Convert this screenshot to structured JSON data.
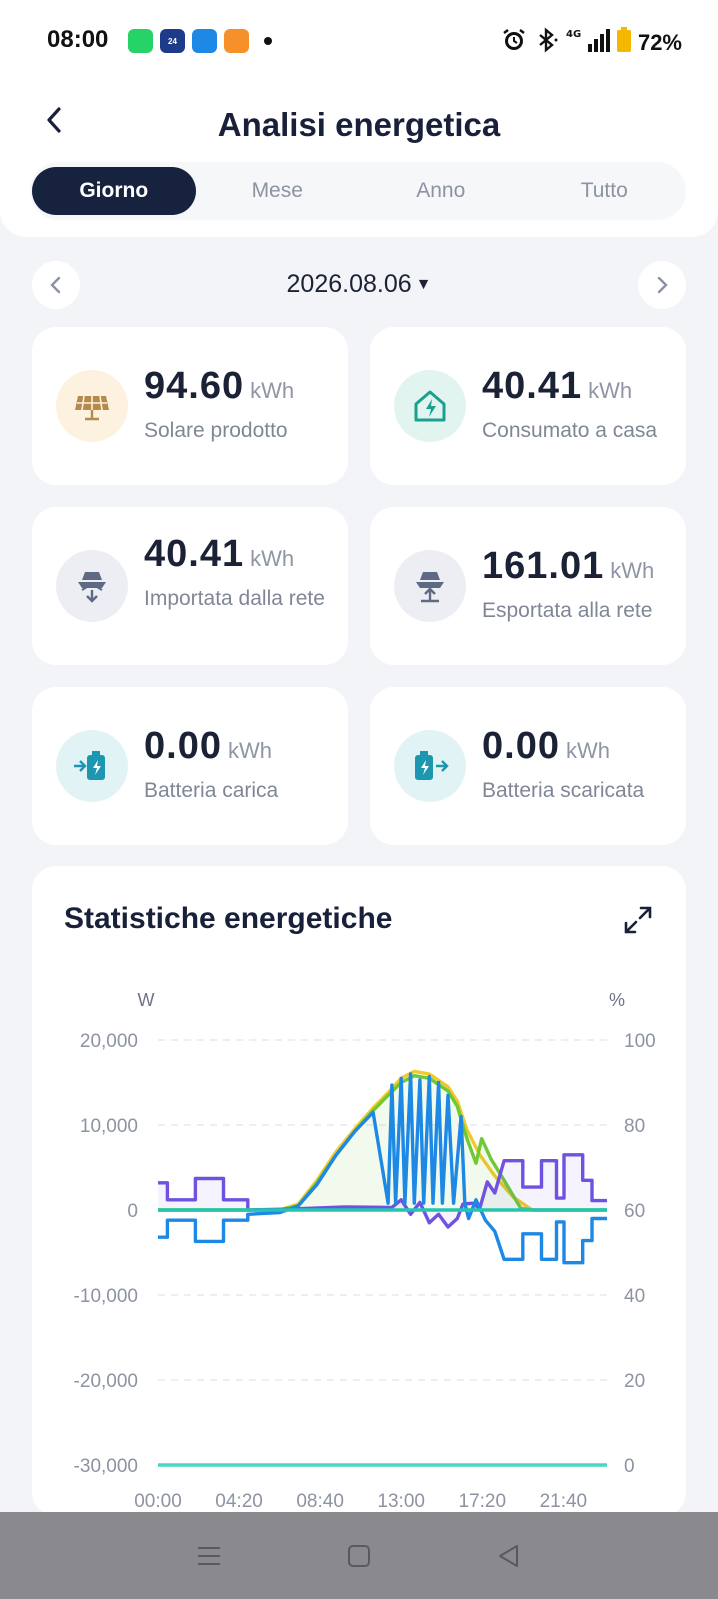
{
  "status": {
    "time": "08:00",
    "battery": "72%",
    "network": "4G",
    "apps": [
      {
        "name": "whatsapp-icon",
        "color": "#25d366",
        "text": ""
      },
      {
        "name": "tgcom24-icon",
        "color": "#1e3a8a",
        "text": "24"
      },
      {
        "name": "news-app-icon",
        "color": "#1e88e5",
        "text": ""
      },
      {
        "name": "orange-app-icon",
        "color": "#f5902a",
        "text": ""
      }
    ]
  },
  "header": {
    "title": "Analisi energetica",
    "tabs": [
      {
        "label": "Giorno",
        "active": true
      },
      {
        "label": "Mese",
        "active": false
      },
      {
        "label": "Anno",
        "active": false
      },
      {
        "label": "Tutto",
        "active": false
      }
    ]
  },
  "date": {
    "label": "2026.08.06"
  },
  "stats": [
    {
      "value": "94.60",
      "unit": "kWh",
      "label": "Solare prodotto",
      "icon": "solar-panel-icon",
      "bg": "#fdf1e0",
      "fg": "#b58a4a"
    },
    {
      "value": "40.41",
      "unit": "kWh",
      "label": "Consumato a casa",
      "icon": "home-energy-icon",
      "bg": "#e2f4f0",
      "fg": "#18a28e"
    },
    {
      "value": "40.41",
      "unit": "kWh",
      "label": "Importata dalla rete",
      "icon": "grid-import-icon",
      "bg": "#eceef3",
      "fg": "#5e6a83"
    },
    {
      "value": "161.01",
      "unit": "kWh",
      "label": "Esportata alla rete",
      "icon": "grid-export-icon",
      "bg": "#eceef3",
      "fg": "#5e6a83"
    },
    {
      "value": "0.00",
      "unit": "kWh",
      "label": "Batteria carica",
      "icon": "battery-charge-icon",
      "bg": "#e2f3f6",
      "fg": "#1d96b0"
    },
    {
      "value": "0.00",
      "unit": "kWh",
      "label": "Batteria scaricata",
      "icon": "battery-discharge-icon",
      "bg": "#e2f3f6",
      "fg": "#1d96b0"
    }
  ],
  "chart_section": {
    "title": "Statistiche energetiche"
  },
  "chart_data": {
    "type": "line",
    "title": "Statistiche energetiche",
    "y_left_unit": "W",
    "y_right_unit": "%",
    "y_left_ticks": [
      "20,000",
      "10,000",
      "0",
      "-10,000",
      "-20,000",
      "-30,000"
    ],
    "y_left_values": [
      20000,
      10000,
      0,
      -10000,
      -20000,
      -30000
    ],
    "y_right_ticks": [
      "100",
      "80",
      "60",
      "40",
      "20",
      "0"
    ],
    "x_ticks": [
      "00:00",
      "04:20",
      "08:40",
      "13:00",
      "17:20",
      "21:40"
    ],
    "ylim": [
      -30000,
      20000
    ],
    "xlim_hours": [
      0,
      24
    ],
    "grid": true,
    "series": [
      {
        "color": "#f0c92c",
        "axis": "left",
        "points": [
          [
            0,
            0
          ],
          [
            5,
            0
          ],
          [
            6.5,
            0
          ],
          [
            7.5,
            700
          ],
          [
            8.5,
            3500
          ],
          [
            9.5,
            6800
          ],
          [
            10.5,
            9500
          ],
          [
            11.5,
            12000
          ],
          [
            12.3,
            13800
          ],
          [
            13,
            15500
          ],
          [
            13.7,
            16300
          ],
          [
            14.5,
            16000
          ],
          [
            15.5,
            14500
          ],
          [
            16,
            12800
          ],
          [
            16.5,
            9500
          ],
          [
            17.2,
            6500
          ],
          [
            18,
            4000
          ],
          [
            19,
            1500
          ],
          [
            20,
            0
          ],
          [
            24,
            0
          ]
        ]
      },
      {
        "color": "#6fc935",
        "axis": "left",
        "points": [
          [
            0,
            0
          ],
          [
            5,
            0
          ],
          [
            6.5,
            0
          ],
          [
            7.5,
            500
          ],
          [
            8.5,
            3200
          ],
          [
            9.5,
            6400
          ],
          [
            10.5,
            9200
          ],
          [
            11.5,
            11700
          ],
          [
            12.3,
            13500
          ],
          [
            13,
            15000
          ],
          [
            13.7,
            15800
          ],
          [
            14.5,
            15500
          ],
          [
            15.5,
            14000
          ],
          [
            16,
            12200
          ],
          [
            16.5,
            8500
          ],
          [
            17,
            5500
          ],
          [
            17.3,
            8400
          ],
          [
            17.8,
            6000
          ],
          [
            18.5,
            3500
          ],
          [
            19.2,
            900
          ],
          [
            19.4,
            200
          ],
          [
            20,
            0
          ],
          [
            24,
            0
          ]
        ]
      },
      {
        "color": "#7052e0",
        "axis": "left",
        "points": [
          [
            0,
            3200
          ],
          [
            0.5,
            3200
          ],
          [
            0.5,
            1200
          ],
          [
            2,
            1200
          ],
          [
            2,
            3700
          ],
          [
            3.5,
            3700
          ],
          [
            3.5,
            1200
          ],
          [
            4.8,
            1200
          ],
          [
            4.8,
            0
          ],
          [
            7,
            100
          ],
          [
            10,
            350
          ],
          [
            12.5,
            300
          ],
          [
            13,
            1200
          ],
          [
            13.5,
            -500
          ],
          [
            14,
            900
          ],
          [
            14.5,
            -1500
          ],
          [
            15,
            -500
          ],
          [
            15.5,
            -2000
          ],
          [
            16,
            -1000
          ],
          [
            16.3,
            700
          ],
          [
            16.8,
            800
          ],
          [
            17.2,
            200
          ],
          [
            17.6,
            3300
          ],
          [
            18,
            2000
          ],
          [
            18.5,
            5800
          ],
          [
            19.5,
            5800
          ],
          [
            19.5,
            2700
          ],
          [
            20.5,
            2700
          ],
          [
            20.5,
            5800
          ],
          [
            21.3,
            5800
          ],
          [
            21.3,
            1400
          ],
          [
            21.7,
            1400
          ],
          [
            21.7,
            6500
          ],
          [
            22.7,
            6500
          ],
          [
            22.7,
            3500
          ],
          [
            23.2,
            3500
          ],
          [
            23.2,
            1100
          ],
          [
            24,
            1100
          ]
        ]
      },
      {
        "color": "#1e88e5",
        "axis": "left",
        "points": [
          [
            0,
            -3200
          ],
          [
            0.5,
            -3200
          ],
          [
            0.5,
            -1200
          ],
          [
            2,
            -1200
          ],
          [
            2,
            -3700
          ],
          [
            3.5,
            -3700
          ],
          [
            3.5,
            -1200
          ],
          [
            4.8,
            -1200
          ],
          [
            4.8,
            -500
          ],
          [
            6.5,
            -300
          ],
          [
            7.5,
            500
          ],
          [
            8.5,
            3000
          ],
          [
            9.5,
            6400
          ],
          [
            10.5,
            9200
          ],
          [
            11.5,
            11500
          ],
          [
            12.3,
            800
          ],
          [
            12.5,
            14700
          ],
          [
            12.7,
            800
          ],
          [
            13,
            15500
          ],
          [
            13.2,
            800
          ],
          [
            13.5,
            16000
          ],
          [
            13.7,
            800
          ],
          [
            14,
            15300
          ],
          [
            14.2,
            800
          ],
          [
            14.5,
            15700
          ],
          [
            14.7,
            800
          ],
          [
            15,
            15000
          ],
          [
            15.2,
            800
          ],
          [
            15.5,
            13500
          ],
          [
            15.8,
            800
          ],
          [
            16.2,
            11000
          ],
          [
            16.4,
            800
          ],
          [
            16.6,
            -1000
          ],
          [
            17,
            1200
          ],
          [
            17.5,
            -1200
          ],
          [
            18,
            -2500
          ],
          [
            18.5,
            -5800
          ],
          [
            19.5,
            -5800
          ],
          [
            19.5,
            -2800
          ],
          [
            20.5,
            -2800
          ],
          [
            20.5,
            -5800
          ],
          [
            21.3,
            -5800
          ],
          [
            21.3,
            -1400
          ],
          [
            21.7,
            -1400
          ],
          [
            21.7,
            -6200
          ],
          [
            22.7,
            -6200
          ],
          [
            22.7,
            -3600
          ],
          [
            23.2,
            -3600
          ],
          [
            23.2,
            -1000
          ],
          [
            24,
            -1000
          ]
        ]
      },
      {
        "color": "#23c4b0",
        "axis": "left",
        "points": [
          [
            0,
            0
          ],
          [
            24,
            0
          ]
        ]
      },
      {
        "color": "#4dd4c8",
        "axis": "right",
        "points": [
          [
            0,
            0
          ],
          [
            24,
            0
          ]
        ]
      }
    ]
  },
  "nav": [
    "menu-nav-icon",
    "home-nav-icon",
    "back-nav-icon"
  ]
}
